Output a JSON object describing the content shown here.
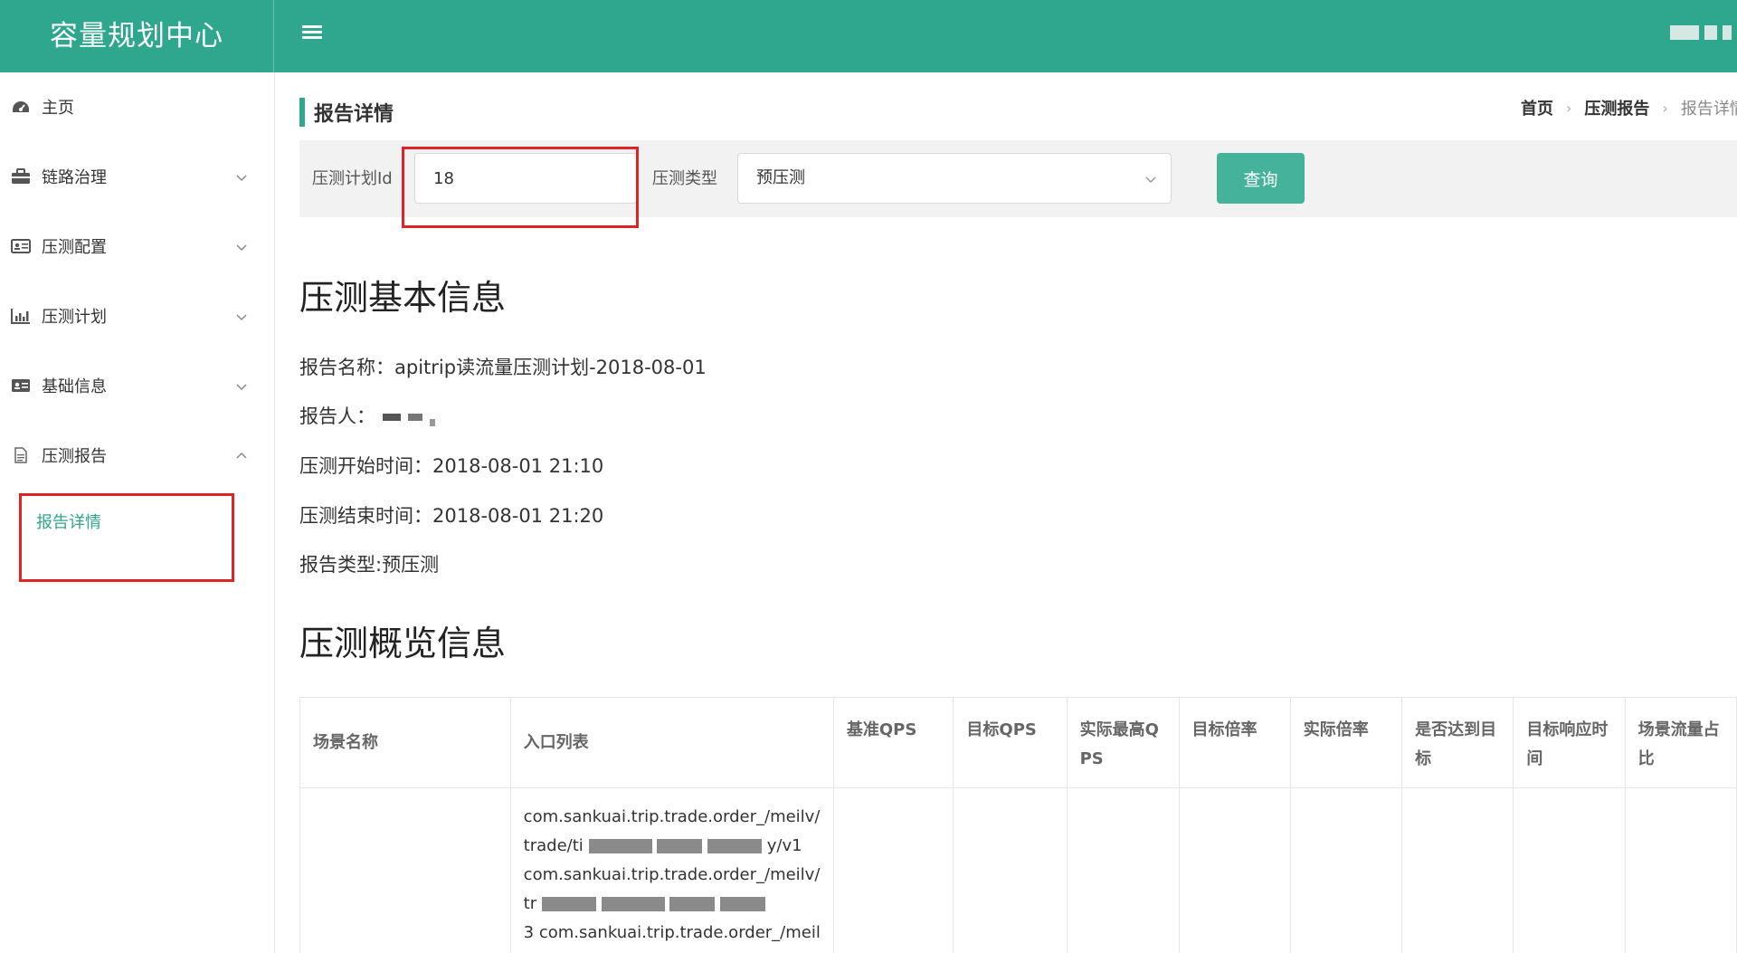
{
  "header": {
    "app_title": "容量规划中心",
    "menu_icon": "hamburger-icon"
  },
  "sidebar": {
    "items": [
      {
        "label": "主页",
        "icon": "dashboard-icon",
        "expandable": false
      },
      {
        "label": "链路治理",
        "icon": "briefcase-icon",
        "expandable": true
      },
      {
        "label": "压测配置",
        "icon": "id-card-icon",
        "expandable": true
      },
      {
        "label": "压测计划",
        "icon": "bar-chart-icon",
        "expandable": true
      },
      {
        "label": "基础信息",
        "icon": "address-card-icon",
        "expandable": true
      },
      {
        "label": "压测报告",
        "icon": "file-icon",
        "expandable": true,
        "expanded": true
      }
    ],
    "sub_item": "报告详情"
  },
  "page": {
    "title": "报告详情",
    "breadcrumb": [
      "首页",
      "压测报告",
      "报告详情"
    ]
  },
  "filter": {
    "plan_id_label": "压测计划Id",
    "plan_id_value": "18",
    "type_label": "压测类型",
    "type_value": "预压测",
    "query_button": "查询"
  },
  "basic_info": {
    "section_title": "压测基本信息",
    "report_name": "报告名称：apitrip读流量压测计划-2018-08-01",
    "reporter": "报告人：",
    "start_time": "压测开始时间：2018-08-01 21:10",
    "end_time": "压测结束时间：2018-08-01 21:20",
    "report_type": "报告类型:预压测"
  },
  "overview": {
    "section_title": "压测概览信息",
    "columns": [
      "场景名称",
      "入口列表",
      "基准QPS",
      "目标QPS",
      "实际最高QPS",
      "目标倍率",
      "实际倍率",
      "是否达到目标",
      "目标响应时间",
      "场景流量占比"
    ],
    "column_lines": [
      [
        "场景名称"
      ],
      [
        "入口列表"
      ],
      [
        "基准QPS"
      ],
      [
        "目标QPS"
      ],
      [
        "实际最高Q",
        "PS"
      ],
      [
        "目标倍率"
      ],
      [
        "实际倍率"
      ],
      [
        "是否达到目",
        "标"
      ],
      [
        "目标响应时",
        "间"
      ],
      [
        "场景流量占",
        "比"
      ]
    ],
    "row_entries": [
      "com.sankuai.trip.trade.order_/meilv/",
      "trade/ti",
      "y/v1",
      "com.sankuai.trip.trade.order_/meilv/",
      "tr",
      "3 com.sankuai.trip.trade.order_/meil"
    ]
  },
  "colors": {
    "primary": "#2fa68e",
    "button": "#45b29b",
    "highlight_box": "#e02424"
  }
}
